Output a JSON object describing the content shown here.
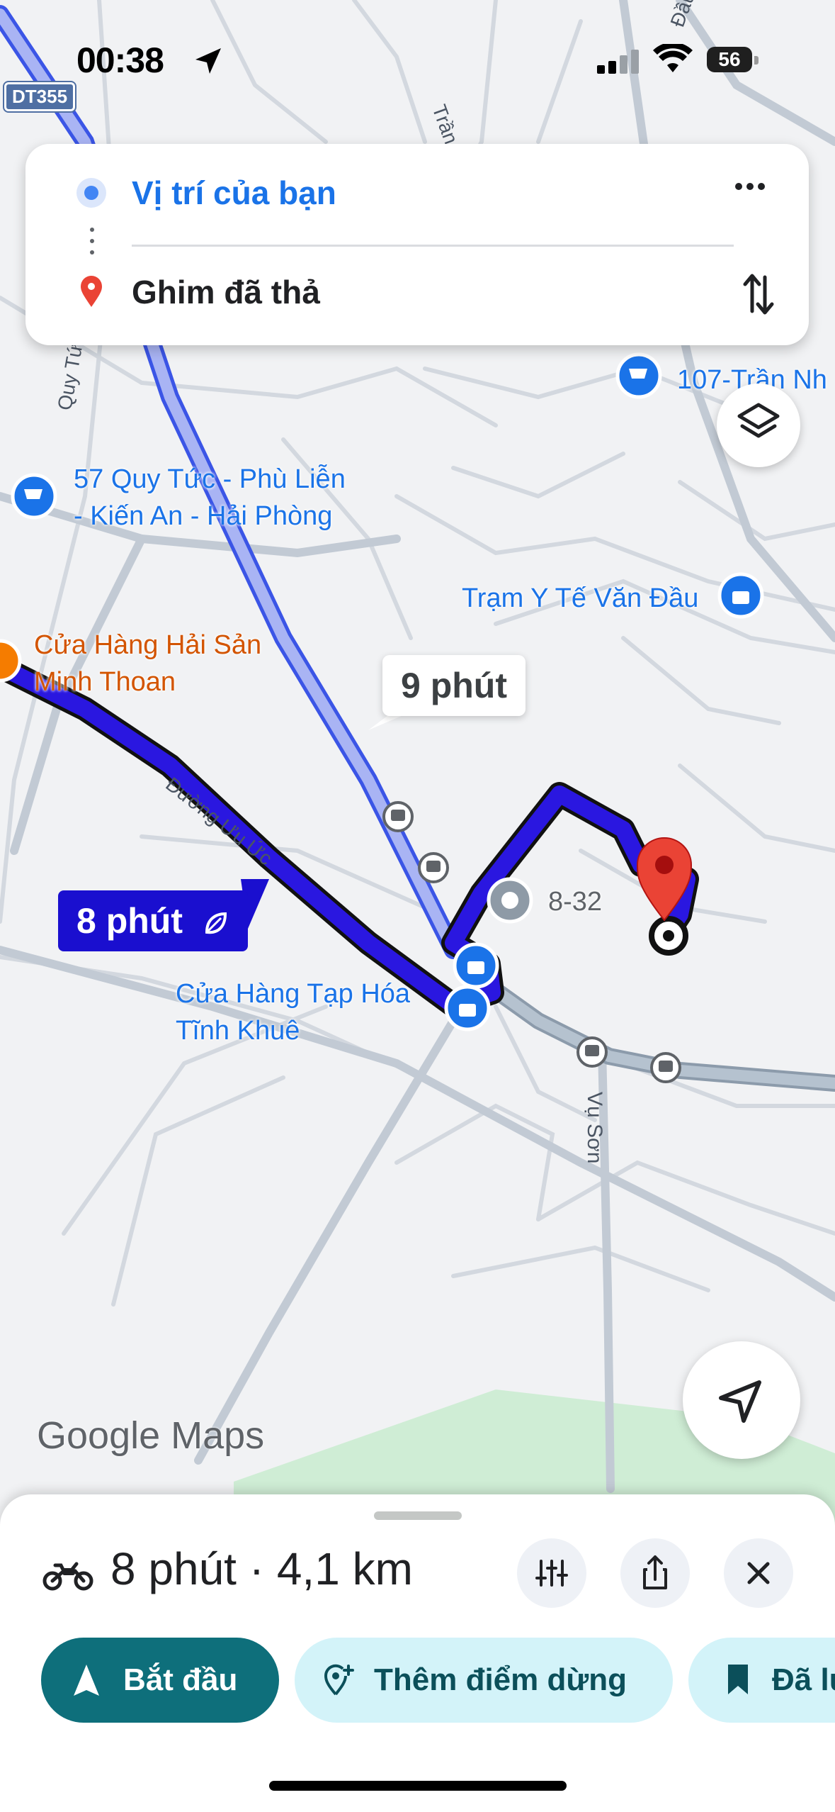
{
  "status_bar": {
    "time": "00:38",
    "battery": "56"
  },
  "map": {
    "road_shield": "DT355",
    "street_labels": [
      "Đường Ưu Ức",
      "Vụ Sơn",
      "Quy Tức",
      "Trần",
      "Đầu Văn"
    ],
    "pois": {
      "quy_tuc_store_line1": "57 Quy Tức - Phù Liễn",
      "quy_tuc_store_line2": "- Kiến An - Hải Phòng",
      "store_107": "107-Trần Nh",
      "health_station": "Trạm Y Tế Văn Đầu",
      "seafood_line1": "Cửa Hàng Hải Sản",
      "seafood_line2": "Minh Thoan",
      "grocery_line1": "Cửa Hàng Tạp Hóa",
      "grocery_line2": "Tĩnh Khuê",
      "place_8_32": "8-32"
    },
    "route_labels": {
      "alternate": "9 phút",
      "selected": "8 phút"
    },
    "logo": "Google Maps",
    "colors": {
      "route": "#2a17e0",
      "alt_route": "#a9b4f4",
      "pin": "#d93025"
    }
  },
  "directions": {
    "from": "Vị trí của bạn",
    "to": "Ghim đã thả"
  },
  "sheet": {
    "summary": "8 phút · 4,1 km",
    "start": "Bắt đầu",
    "add_stop": "Thêm điểm dừng",
    "save": "Đã lưu"
  }
}
